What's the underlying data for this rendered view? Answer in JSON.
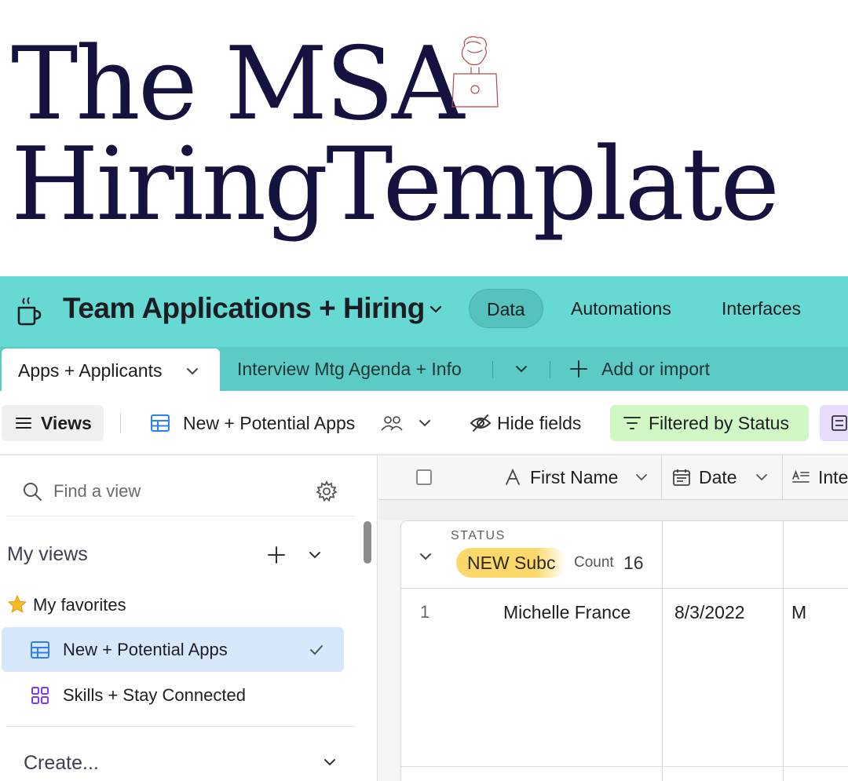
{
  "hero": {
    "line1": "The MSA",
    "line2": "HiringTemplate",
    "title_color": "#16123f",
    "illustration": "person-with-laptop-sketch"
  },
  "header": {
    "base_icon": "coffee-cup-icon",
    "base_title": "Team Applications + Hiring",
    "nav": {
      "data": "Data",
      "automations": "Automations",
      "interfaces": "Interfaces"
    },
    "accent": "#67d9d3"
  },
  "tabs": {
    "active": "Apps + Applicants",
    "second": "Interview Mtg Agenda + Info",
    "add": "Add or import"
  },
  "viewbar": {
    "views_label": "Views",
    "current_view": "New + Potential Apps",
    "hide_fields": "Hide fields",
    "filter": "Filtered by Status",
    "filter_color": "#d1f7c4",
    "group_color": "#e8dcfc"
  },
  "sidebar": {
    "search_placeholder": "Find a view",
    "my_views": "My views",
    "favorites": "My favorites",
    "items": [
      {
        "label": "New + Potential Apps",
        "icon": "grid-view-icon",
        "selected": true
      },
      {
        "label": "Skills + Stay Connected",
        "icon": "gallery-view-icon",
        "selected": false
      }
    ],
    "create": "Create..."
  },
  "grid": {
    "columns": [
      {
        "label": "First Name",
        "icon": "text-a-icon"
      },
      {
        "label": "Date",
        "icon": "calendar-icon"
      },
      {
        "label": "Inte",
        "icon": "long-text-icon"
      }
    ],
    "group": {
      "field_label": "STATUS",
      "value": "NEW Subc",
      "count_label": "Count",
      "count": "16"
    },
    "rows": [
      {
        "num": "1",
        "first_name": "Michelle France",
        "date": "8/3/2022",
        "inte": "M"
      }
    ]
  }
}
